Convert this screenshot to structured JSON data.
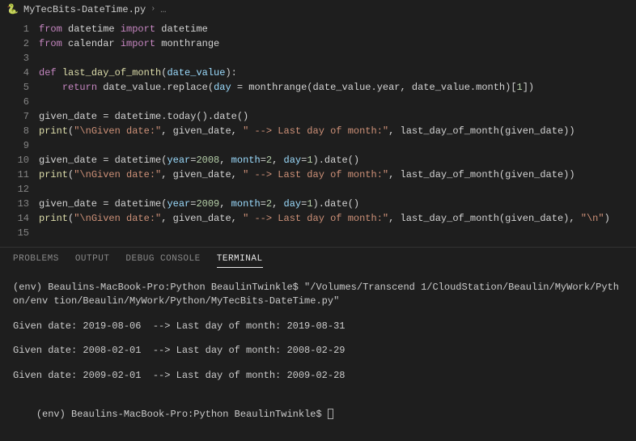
{
  "breadcrumb": {
    "file_icon": "🐍",
    "filename": "MyTecBits-DateTime.py",
    "chevron": "›",
    "ellipsis": "…"
  },
  "editor": {
    "lines": [
      {
        "no": "1",
        "tokens": [
          [
            "kw",
            "from"
          ],
          [
            "plain",
            " datetime "
          ],
          [
            "kw",
            "import"
          ],
          [
            "plain",
            " datetime"
          ]
        ]
      },
      {
        "no": "2",
        "tokens": [
          [
            "kw",
            "from"
          ],
          [
            "plain",
            " calendar "
          ],
          [
            "kw",
            "import"
          ],
          [
            "plain",
            " monthrange"
          ]
        ]
      },
      {
        "no": "3",
        "tokens": []
      },
      {
        "no": "4",
        "tokens": [
          [
            "kw",
            "def"
          ],
          [
            "plain",
            " "
          ],
          [
            "fn",
            "last_day_of_month"
          ],
          [
            "plain",
            "("
          ],
          [
            "var",
            "date_value"
          ],
          [
            "plain",
            "):"
          ]
        ]
      },
      {
        "no": "5",
        "tokens": [
          [
            "plain",
            "    "
          ],
          [
            "kw",
            "return"
          ],
          [
            "plain",
            " date_value.replace("
          ],
          [
            "var",
            "day"
          ],
          [
            "plain",
            " = monthrange(date_value.year, date_value.month)["
          ],
          [
            "num",
            "1"
          ],
          [
            "plain",
            "])"
          ]
        ]
      },
      {
        "no": "6",
        "tokens": []
      },
      {
        "no": "7",
        "tokens": [
          [
            "plain",
            "given_date = datetime.today().date()"
          ]
        ]
      },
      {
        "no": "8",
        "tokens": [
          [
            "fn",
            "print"
          ],
          [
            "plain",
            "("
          ],
          [
            "str",
            "\"\\nGiven date:\""
          ],
          [
            "plain",
            ", given_date, "
          ],
          [
            "str",
            "\" --> Last day of month:\""
          ],
          [
            "plain",
            ", last_day_of_month(given_date))"
          ]
        ]
      },
      {
        "no": "9",
        "tokens": []
      },
      {
        "no": "10",
        "tokens": [
          [
            "plain",
            "given_date = datetime("
          ],
          [
            "var",
            "year"
          ],
          [
            "plain",
            "="
          ],
          [
            "num",
            "2008"
          ],
          [
            "plain",
            ", "
          ],
          [
            "var",
            "month"
          ],
          [
            "plain",
            "="
          ],
          [
            "num",
            "2"
          ],
          [
            "plain",
            ", "
          ],
          [
            "var",
            "day"
          ],
          [
            "plain",
            "="
          ],
          [
            "num",
            "1"
          ],
          [
            "plain",
            ").date()"
          ]
        ]
      },
      {
        "no": "11",
        "tokens": [
          [
            "fn",
            "print"
          ],
          [
            "plain",
            "("
          ],
          [
            "str",
            "\"\\nGiven date:\""
          ],
          [
            "plain",
            ", given_date, "
          ],
          [
            "str",
            "\" --> Last day of month:\""
          ],
          [
            "plain",
            ", last_day_of_month(given_date))"
          ]
        ]
      },
      {
        "no": "12",
        "tokens": []
      },
      {
        "no": "13",
        "tokens": [
          [
            "plain",
            "given_date = datetime("
          ],
          [
            "var",
            "year"
          ],
          [
            "plain",
            "="
          ],
          [
            "num",
            "2009"
          ],
          [
            "plain",
            ", "
          ],
          [
            "var",
            "month"
          ],
          [
            "plain",
            "="
          ],
          [
            "num",
            "2"
          ],
          [
            "plain",
            ", "
          ],
          [
            "var",
            "day"
          ],
          [
            "plain",
            "="
          ],
          [
            "num",
            "1"
          ],
          [
            "plain",
            ").date()"
          ]
        ]
      },
      {
        "no": "14",
        "tokens": [
          [
            "fn",
            "print"
          ],
          [
            "plain",
            "("
          ],
          [
            "str",
            "\"\\nGiven date:\""
          ],
          [
            "plain",
            ", given_date, "
          ],
          [
            "str",
            "\" --> Last day of month:\""
          ],
          [
            "plain",
            ", last_day_of_month(given_date), "
          ],
          [
            "str",
            "\"\\n\""
          ],
          [
            "plain",
            ")"
          ]
        ]
      },
      {
        "no": "15",
        "tokens": []
      }
    ]
  },
  "panel": {
    "tabs": [
      "PROBLEMS",
      "OUTPUT",
      "DEBUG CONSOLE",
      "TERMINAL"
    ],
    "active": 3
  },
  "terminal": {
    "prompt1": "(env) Beaulins-MacBook-Pro:Python BeaulinTwinkle$ \"/Volumes/Transcend 1/CloudStation/Beaulin/MyWork/Python/env tion/Beaulin/MyWork/Python/MyTecBits-DateTime.py\"",
    "out1": "Given date: 2019-08-06  --> Last day of month: 2019-08-31",
    "out2": "Given date: 2008-02-01  --> Last day of month: 2008-02-29",
    "out3": "Given date: 2009-02-01  --> Last day of month: 2009-02-28",
    "prompt2": "(env) Beaulins-MacBook-Pro:Python BeaulinTwinkle$ "
  }
}
